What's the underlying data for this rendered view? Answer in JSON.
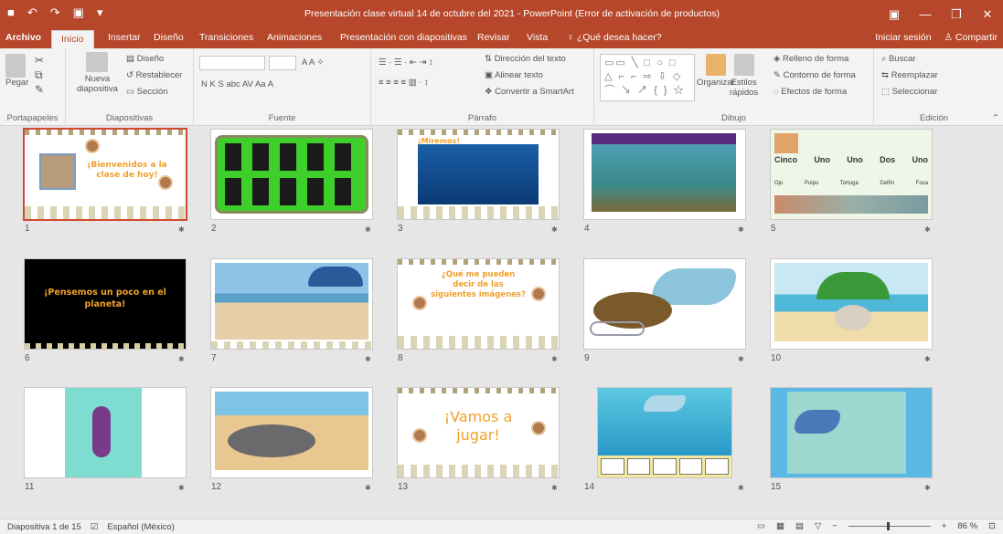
{
  "window": {
    "title": "Presentación clase virtual 14 de octubre del 2021 - PowerPoint (Error de activación de productos)",
    "qat_icons": [
      "save-icon",
      "undo-icon",
      "redo-icon",
      "present-icon",
      "customize-icon"
    ]
  },
  "tabs": {
    "items": [
      "Archivo",
      "Inicio",
      "Insertar",
      "Diseño",
      "Transiciones",
      "Animaciones",
      "Presentación con diapositivas",
      "Revisar",
      "Vista"
    ],
    "tellme": "¿Qué desea hacer?",
    "signin": "Iniciar sesión",
    "share": "Compartir"
  },
  "ribbon": {
    "clipboard": {
      "paste": "Pegar",
      "label": "Portapapeles"
    },
    "slides": {
      "new_slide_1": "Nueva",
      "new_slide_2": "diapositiva",
      "layout": "Diseño",
      "reset": "Restablecer",
      "section": "Sección",
      "label": "Diapositivas"
    },
    "font": {
      "label": "Fuente",
      "format_row": "N K S abc AV Aa A"
    },
    "paragraph": {
      "text_direction": "Dirección del texto",
      "align_text": "Alinear texto",
      "smartart": "Convertir a SmartArt",
      "label": "Párrafo"
    },
    "drawing": {
      "arrange": "Organizar",
      "quick_styles_1": "Estilos",
      "quick_styles_2": "rápidos",
      "fill": "Relleno de forma",
      "outline": "Contorno de forma",
      "effects": "Efectos de forma",
      "label": "Dibujo"
    },
    "editing": {
      "find": "Buscar",
      "replace": "Reemplazar",
      "select": "Seleccionar",
      "label": "Edición"
    }
  },
  "slides": [
    {
      "num": "1",
      "text": "¡Bienvenidos a la clase de hoy!"
    },
    {
      "num": "2",
      "text": ""
    },
    {
      "num": "3",
      "text": "¡Miremos!"
    },
    {
      "num": "4",
      "text": ""
    },
    {
      "num": "5",
      "text": ""
    },
    {
      "num": "6",
      "text": "¡Pensemos un poco en el planeta!"
    },
    {
      "num": "7",
      "text": ""
    },
    {
      "num": "8",
      "text": "¿Qué me pueden decir de las siguientes imágenes?"
    },
    {
      "num": "9",
      "text": ""
    },
    {
      "num": "10",
      "text": ""
    },
    {
      "num": "11",
      "text": ""
    },
    {
      "num": "12",
      "text": ""
    },
    {
      "num": "13",
      "text": "¡Vamos a jugar!"
    },
    {
      "num": "14",
      "text": ""
    },
    {
      "num": "15",
      "text": ""
    }
  ],
  "slide5_table": {
    "row1": [
      "Cinco",
      "Uno",
      "Uno",
      "Dos",
      "Uno"
    ],
    "row2": [
      "Ojo",
      "Pulpo",
      "Tortuga",
      "Delfín",
      "Foca"
    ]
  },
  "status": {
    "slide_count": "Diapositiva 1 de 15",
    "language": "Español (México)",
    "zoom": "86 %"
  },
  "colors": {
    "accent": "#b7472a",
    "selected": "#d04a2f",
    "title_orange": "#f0a02a"
  }
}
